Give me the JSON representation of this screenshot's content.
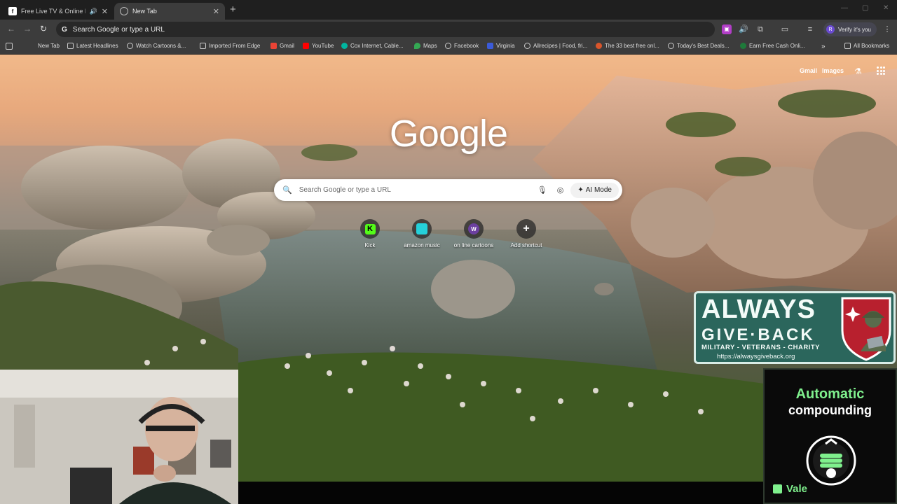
{
  "tabs": [
    {
      "title": "Free Live TV & Online Radio",
      "favicon": "f",
      "active": false,
      "audio": true
    },
    {
      "title": "New Tab",
      "favicon": "",
      "active": true,
      "audio": false
    }
  ],
  "toolbar": {
    "omnibox_text": "Search Google or type a URL",
    "verify_label": "Verify it's you",
    "profile_initial": "R"
  },
  "bookmarks": [
    {
      "label": "New Tab",
      "icon": "grid-icon"
    },
    {
      "label": "Latest Headlines",
      "icon": "folder-icon"
    },
    {
      "label": "Watch Cartoons &...",
      "icon": "globe-icon"
    },
    {
      "label": "Imported From Edge",
      "icon": "folder-icon"
    },
    {
      "label": "Gmail",
      "icon": "gmail-icon"
    },
    {
      "label": "YouTube",
      "icon": "youtube-icon"
    },
    {
      "label": "Cox Internet, Cable...",
      "icon": "cox-icon"
    },
    {
      "label": "Maps",
      "icon": "maps-icon"
    },
    {
      "label": "Facebook",
      "icon": "globe-icon"
    },
    {
      "label": "Virginia",
      "icon": "virginia-icon"
    },
    {
      "label": "Allrecipes | Food, fri...",
      "icon": "globe-icon"
    },
    {
      "label": "The 33 best free onl...",
      "icon": "site-icon"
    },
    {
      "label": "Today's Best Deals...",
      "icon": "globe-icon"
    },
    {
      "label": "Earn Free Cash Onli...",
      "icon": "site-icon"
    },
    {
      "label": "All Bookmarks",
      "icon": "folder-icon"
    }
  ],
  "google": {
    "links": [
      "Gmail",
      "Images"
    ],
    "logo": "Google",
    "search_placeholder": "Search Google or type a URL",
    "ai_mode_label": "AI Mode",
    "shortcuts": [
      {
        "label": "Kick",
        "color": "#53fc18"
      },
      {
        "label": "amazon music",
        "color": "#25d1da"
      },
      {
        "label": "on line cartoons",
        "color": "#6b3fa0"
      },
      {
        "label": "Add shortcut",
        "color": "#ffffff"
      }
    ]
  },
  "overlay_banner": {
    "line1": "ALWAYS",
    "line2": "GIVE·BACK",
    "line3": "MILITARY - VETERANS - CHARITY",
    "url": "https://alwaysgiveback.org"
  },
  "ad": {
    "line1": "Automatic",
    "line2": "compounding",
    "brand": "Vale"
  },
  "colors": {
    "banner_bg": "#2b665c",
    "ad_accent": "#7ff08d"
  }
}
